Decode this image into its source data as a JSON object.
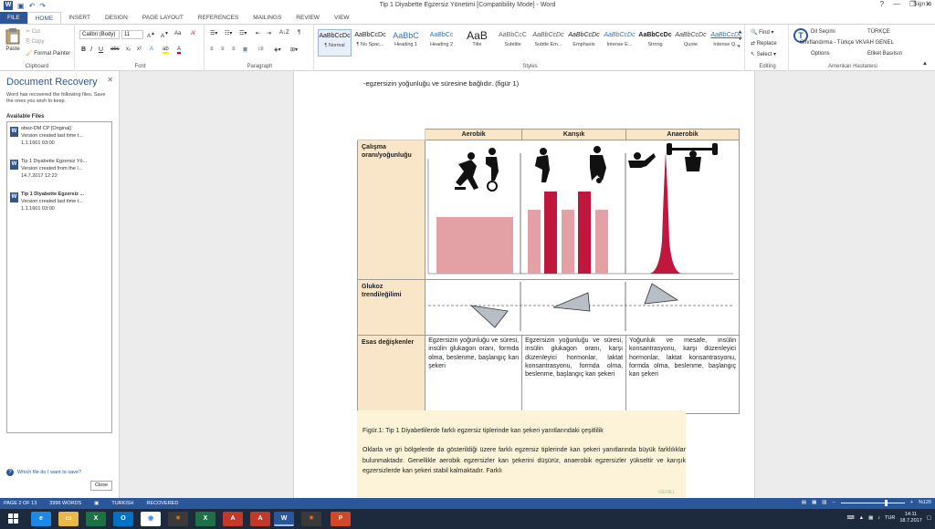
{
  "window": {
    "title": "Tip 1 Diyabette Egzersiz Yönetimi [Compatibility Mode] - Word",
    "help": "?",
    "minimize": "—",
    "restore": "❐",
    "close": "✕",
    "sign_in": "Sign in"
  },
  "quick_access": {
    "undo": "↶",
    "redo": "↷",
    "save": "▣"
  },
  "tabs": [
    "FILE",
    "HOME",
    "INSERT",
    "DESIGN",
    "PAGE LAYOUT",
    "REFERENCES",
    "MAILINGS",
    "REVIEW",
    "VIEW"
  ],
  "active_tab": "HOME",
  "ribbon": {
    "clipboard": {
      "paste": "Paste",
      "cut": "Cut",
      "copy": "Copy",
      "format_painter": "Format Painter",
      "label": "Clipboard"
    },
    "font": {
      "name": "Calibri (Body)",
      "size": "11",
      "label": "Font",
      "bold": "B",
      "italic": "I",
      "underline": "U"
    },
    "paragraph": {
      "label": "Paragraph"
    },
    "styles": {
      "label": "Styles",
      "items": [
        {
          "preview": "AaBbCcDc",
          "name": "¶ Normal"
        },
        {
          "preview": "AaBbCcDc",
          "name": "¶ No Spac..."
        },
        {
          "preview": "AaBbC",
          "name": "Heading 1"
        },
        {
          "preview": "AaBbCc",
          "name": "Heading 2"
        },
        {
          "preview": "AaB",
          "name": "Title"
        },
        {
          "preview": "AaBbCcC",
          "name": "Subtitle"
        },
        {
          "preview": "AaBbCcDc",
          "name": "Subtle Em..."
        },
        {
          "preview": "AaBbCcDc",
          "name": "Emphasis"
        },
        {
          "preview": "AaBbCcDc",
          "name": "Intense E..."
        },
        {
          "preview": "AaBbCcDc",
          "name": "Strong"
        },
        {
          "preview": "AaBbCcDc",
          "name": "Quote"
        },
        {
          "preview": "AaBbCcDc",
          "name": "Intense Q..."
        }
      ]
    },
    "editing": {
      "find": "Find",
      "replace": "Replace",
      "select": "Select",
      "label": "Editing"
    },
    "amenkan": {
      "dil_secimi": "Dil Seçimi",
      "turkce": "TÜRKÇE",
      "siniflandirma": "Sınıflandırma - Türkçe VKVAH GENEL",
      "options": "Options",
      "etiket": "Etiket Basılsın",
      "label": "Amenkan Hastanesi"
    }
  },
  "recovery": {
    "title": "Document Recovery",
    "message": "Word has recovered the following files. Save the ones you wish to keep.",
    "available": "Available Files",
    "files": [
      {
        "name": "obez-DM CP [Original]",
        "line2": "Version created last time t...",
        "date": "1.1.1601 03:00"
      },
      {
        "name": "Tip 1 Diyabette Egzersiz Yö...",
        "line2": "Version created from the l...",
        "date": "14.7.2017 12:22"
      },
      {
        "name": "Tip 1 Diyabette Egzersiz ...",
        "line2": "Version created last time t...",
        "date": "1.1.1601 03:00"
      }
    ],
    "help": "Which file do I want to save?",
    "close_button": "Close"
  },
  "document": {
    "intro": "-egzersizin yoğunluğu ve süresine bağlıdır. (figür 1)",
    "table": {
      "headers": [
        "Aerobik",
        "Karışık",
        "Anaerobik"
      ],
      "rows": [
        {
          "label": "Çalışma oranı/yoğunluğu"
        },
        {
          "label": "Glukoz trendi/eğilimi"
        },
        {
          "label": "Esas değişkenler",
          "cells": [
            "Egzersizin yoğunluğu ve süresi, insülin glukagon oranı, formda olma, beslenme, başlangıç kan şekeri",
            "Egzersizin yoğunluğu ve süresi, insülin glukagon oranı, karşı düzenleyici hormonlar, laktat konsantrasyonu, formda olma, beslenme, başlangıç kan şekeri",
            "Yoğunluk ve mesafe, insülin konsantrasyonu, karşı düzenleyici hormonlar, laktat konsantrasyonu, formda olma, beslenme, başlangıç kan şekeri"
          ]
        }
      ]
    },
    "caption": "Figür.1: Tip 1 Diyabetlilerde farklı egzersiz tiplerinde kan şekeri yanıtlarındaki çeşitlilik",
    "body": "Oklarla ve gri bölgelerde da gösterildiği üzere farklı egzersiz tiplerinde kan şekeri yanıtlarında büyük farklılıklar bulunmaktadır. Genellikle aerobik egzersizler kan şekerini düşürür, anaerobik egzersizler yükseltir ve karışık egzersizlerde kan şekeri stabil kalmaktadır. Farklı",
    "tag": "GENEL"
  },
  "status": {
    "page": "PAGE 2 OF 13",
    "words": "3996 WORDS",
    "language": "TURKISH",
    "state": "RECOVERED",
    "zoom": "%120"
  },
  "taskbar": {
    "lang": "TUR",
    "time": "14:11",
    "date": "18.7.2017"
  },
  "colors": {
    "accent": "#2b579a",
    "bar_light": "#e3a0a5",
    "bar_dark": "#c0173f",
    "table_header": "#f9e6c8"
  }
}
